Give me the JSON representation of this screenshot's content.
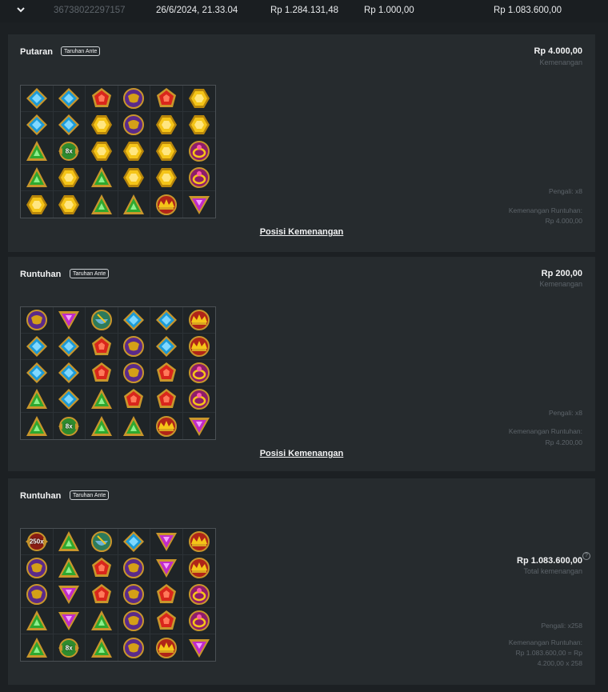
{
  "summary_row": {
    "id": "36738022297157",
    "datetime": "26/6/2024, 21.33.04",
    "balance": "Rp 1.284.131,48",
    "bet": "Rp 1.000,00",
    "win": "Rp 1.083.600,00"
  },
  "panels": [
    {
      "title": "Putaran",
      "badge": "Taruhan Ante",
      "amount": "Rp 4.000,00",
      "amount_label": "Kemenangan",
      "multiplier": "Pengali: x8",
      "cascade_label": "Kemenangan Runtuhan:",
      "cascade_value": "Rp 4.000,00",
      "link": "Posisi Kemenangan",
      "grid": [
        [
          "blue",
          "blue",
          "red",
          "purple",
          "red",
          "gold"
        ],
        [
          "blue",
          "blue",
          "gold",
          "purple",
          "gold",
          "gold"
        ],
        [
          "green",
          "mult",
          "gold",
          "gold",
          "gold",
          "ring"
        ],
        [
          "green",
          "gold",
          "green",
          "gold",
          "gold",
          "ring"
        ],
        [
          "gold",
          "gold",
          "green",
          "green",
          "crown",
          "pink"
        ]
      ],
      "mult_labels": [
        "8x"
      ]
    },
    {
      "title": "Runtuhan",
      "badge": "Taruhan Ante",
      "amount": "Rp 200,00",
      "amount_label": "Kemenangan",
      "multiplier": "Pengali: x8",
      "cascade_label": "Kemenangan Runtuhan:",
      "cascade_value": "Rp 4.200,00",
      "link": "Posisi Kemenangan",
      "grid": [
        [
          "purple",
          "pink",
          "bowl",
          "blue",
          "blue",
          "crown"
        ],
        [
          "blue",
          "blue",
          "red",
          "purple",
          "blue",
          "crown"
        ],
        [
          "blue",
          "blue",
          "red",
          "purple",
          "red",
          "ring"
        ],
        [
          "green",
          "blue",
          "green",
          "red",
          "red",
          "ring"
        ],
        [
          "green",
          "mult",
          "green",
          "green",
          "crown",
          "pink"
        ]
      ],
      "mult_labels": [
        "8x"
      ]
    },
    {
      "title": "Runtuhan",
      "badge": "Taruhan Ante",
      "amount": "Rp 1.083.600,00",
      "amount_label": "Total kemenangan",
      "multiplier": "Pengali: x258",
      "cascade_label": "Kemenangan Runtuhan:",
      "cascade_line2": "Rp 1.083.600,00 = Rp",
      "cascade_line3": "4.200,00 x 258",
      "help": "?",
      "grid": [
        [
          "mult250",
          "green",
          "bowl",
          "blue",
          "pink",
          "crown"
        ],
        [
          "purple",
          "green",
          "red",
          "purple",
          "pink",
          "crown"
        ],
        [
          "purple",
          "pink",
          "red",
          "purple",
          "red",
          "ring"
        ],
        [
          "green",
          "pink",
          "green",
          "purple",
          "red",
          "ring"
        ],
        [
          "green",
          "mult",
          "green",
          "purple",
          "crown",
          "pink"
        ]
      ],
      "mult_labels": [
        "250x",
        "8x"
      ]
    }
  ],
  "colors": {
    "background": "#1c2023",
    "panel": "#262b2e",
    "muted_text": "#5d646a",
    "text": "#f2f3f4"
  }
}
